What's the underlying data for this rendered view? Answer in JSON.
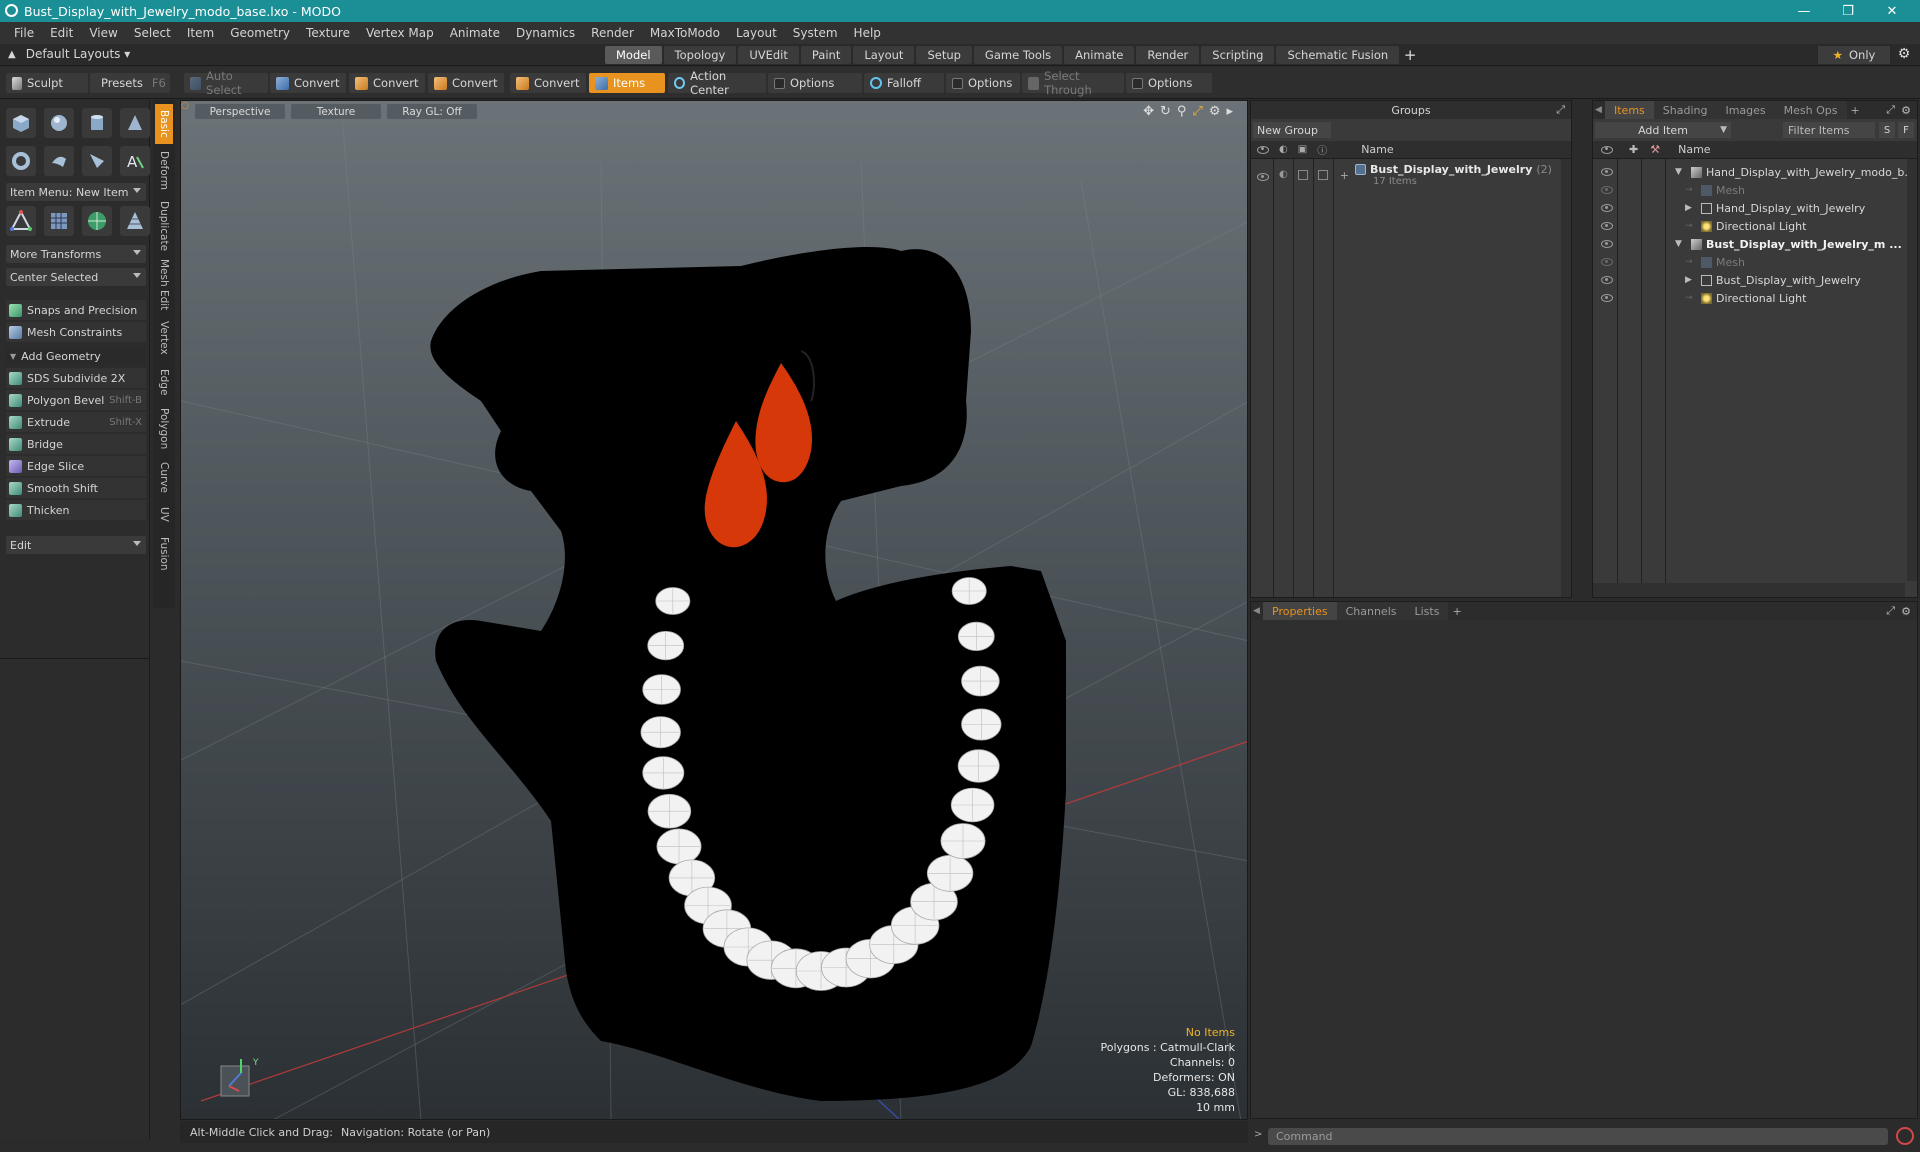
{
  "window": {
    "title": "Bust_Display_with_Jewelry_modo_base.lxo - MODO"
  },
  "menu": [
    "File",
    "Edit",
    "View",
    "Select",
    "Item",
    "Geometry",
    "Texture",
    "Vertex Map",
    "Animate",
    "Dynamics",
    "Render",
    "MaxToModo",
    "Layout",
    "System",
    "Help"
  ],
  "layout_bar": {
    "default_layouts": "Default Layouts",
    "tabs": [
      "Model",
      "Topology",
      "UVEdit",
      "Paint",
      "Layout",
      "Setup",
      "Game Tools",
      "Animate",
      "Render",
      "Scripting",
      "Schematic Fusion"
    ],
    "active_tab": "Model",
    "only_label": "Only"
  },
  "toolbar": {
    "sculpt": "Sculpt",
    "presets": "Presets",
    "presets_shortcut": "F6",
    "auto_select": "Auto Select",
    "convert1": "Convert",
    "convert2": "Convert",
    "convert3": "Convert",
    "convert4": "Convert",
    "items": "Items",
    "action_center": "Action Center",
    "options1": "Options",
    "falloff": "Falloff",
    "options2": "Options",
    "select_through": "Select Through",
    "options3": "Options"
  },
  "left_panel": {
    "item_menu": "Item Menu: New Item",
    "more_transforms": "More Transforms",
    "center_selected": "Center Selected",
    "snaps": "Snaps and Precision",
    "mesh_constraints": "Mesh Constraints",
    "add_geometry": "Add Geometry",
    "tools": [
      {
        "label": "SDS Subdivide 2X",
        "shortcut": ""
      },
      {
        "label": "Polygon Bevel",
        "shortcut": "Shift-B"
      },
      {
        "label": "Extrude",
        "shortcut": "Shift-X"
      },
      {
        "label": "Bridge",
        "shortcut": ""
      },
      {
        "label": "Edge Slice",
        "shortcut": ""
      },
      {
        "label": "Smooth Shift",
        "shortcut": ""
      },
      {
        "label": "Thicken",
        "shortcut": ""
      }
    ],
    "edit": "Edit"
  },
  "side_tabs": [
    "Basic",
    "Deform",
    "Duplicate",
    "Mesh Edit",
    "Vertex",
    "Edge",
    "Polygon",
    "Curve",
    "UV",
    "Fusion"
  ],
  "viewport": {
    "view_mode": "Perspective",
    "shading": "Texture",
    "raygl": "Ray GL: Off",
    "info": {
      "selection": "No Items",
      "polygons": "Polygons : Catmull-Clark",
      "channels": "Channels: 0",
      "deformers": "Deformers: ON",
      "gl": "GL: 838,688",
      "unit": "10 mm"
    },
    "axis_label": "Y"
  },
  "status": {
    "hint_key": "Alt-Middle Click and Drag:",
    "hint_text": "Navigation: Rotate (or Pan)"
  },
  "groups_panel": {
    "title": "Groups",
    "new_group": "New Group",
    "col_name": "Name",
    "group_name": "Bust_Display_with_Jewelry",
    "group_count": "(2)",
    "group_items": "17 Items"
  },
  "items_panel": {
    "tabs": [
      "Items",
      "Shading",
      "Images",
      "Mesh Ops"
    ],
    "add_item": "Add Item",
    "filter_placeholder": "Filter Items",
    "s_btn": "S",
    "f_btn": "F",
    "col_name": "Name",
    "rows": [
      {
        "label": "Hand_Display_with_Jewelry_modo_b...",
        "level": 0,
        "bold": false,
        "dim": false
      },
      {
        "label": "Mesh",
        "level": 1,
        "bold": false,
        "dim": true
      },
      {
        "label": "Hand_Display_with_Jewelry",
        "level": 1,
        "bold": false,
        "dim": false
      },
      {
        "label": "Directional Light",
        "level": 1,
        "bold": false,
        "dim": false
      },
      {
        "label": "Bust_Display_with_Jewelry_m ...",
        "level": 0,
        "bold": true,
        "dim": false
      },
      {
        "label": "Mesh",
        "level": 1,
        "bold": false,
        "dim": true
      },
      {
        "label": "Bust_Display_with_Jewelry",
        "level": 1,
        "bold": false,
        "dim": false
      },
      {
        "label": "Directional Light",
        "level": 1,
        "bold": false,
        "dim": false
      }
    ]
  },
  "properties_panel": {
    "tabs": [
      "Properties",
      "Channels",
      "Lists"
    ]
  },
  "command": {
    "placeholder": "Command"
  },
  "colors": {
    "accent": "#e8931f",
    "title_bar": "#1a8f96",
    "earring": "#d6380a",
    "bust": "#000000",
    "pearl": "#f2f2f2"
  }
}
